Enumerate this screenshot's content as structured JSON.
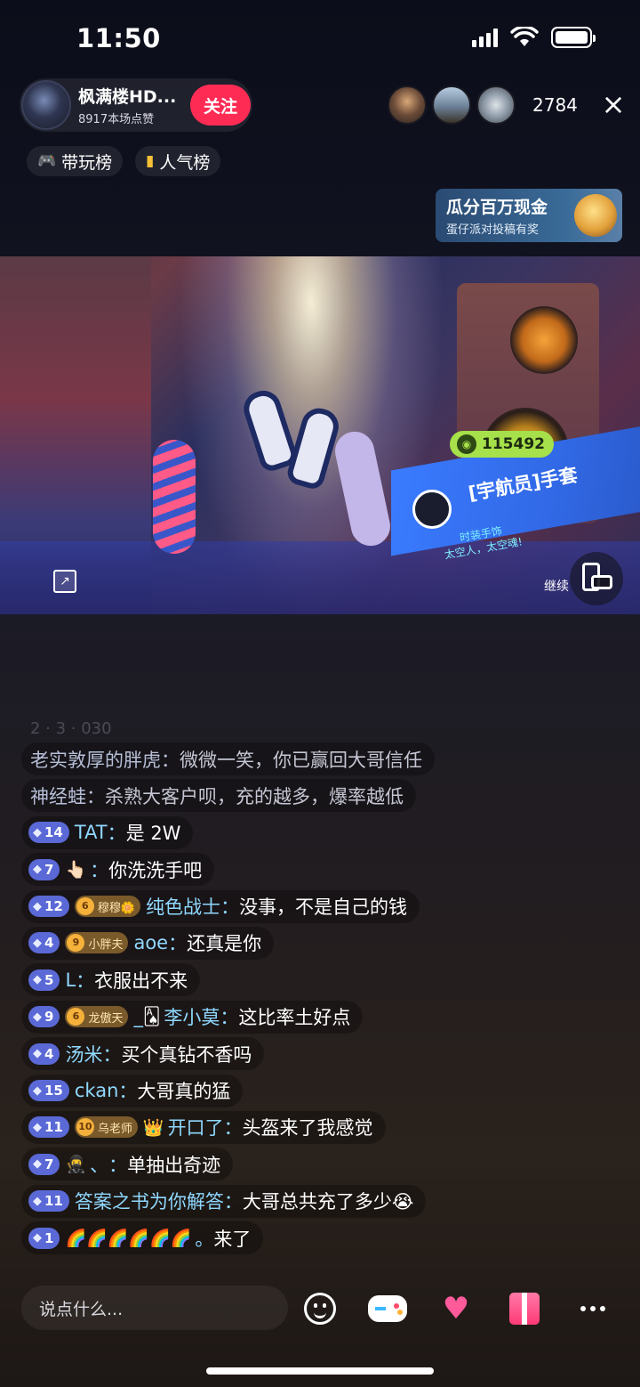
{
  "status_bar": {
    "time": "11:50"
  },
  "header": {
    "host_name": "枫满楼HD...",
    "host_likes": "8917本场点赞",
    "follow_label": "关注",
    "viewer_count": "2784",
    "close_icon": "×"
  },
  "rankings": [
    {
      "icon": "gamepad-icon",
      "label": "带玩榜"
    },
    {
      "icon": "bar-chart-icon",
      "label": "人气榜"
    }
  ],
  "promo": {
    "title": "瓜分百万现金",
    "subtitle": "蛋仔派对投稿有奖"
  },
  "video": {
    "coin_value": "115492",
    "item_name": "[宇航员]手套",
    "item_tag_line1": "时装手饰",
    "item_tag_line2": "太空人，太空魂!",
    "continue_label": "继续"
  },
  "chat": {
    "faded_line": "2 · 3 · 030",
    "messages": [
      {
        "name": "老实敦厚的胖虎",
        "sep": "：",
        "text": "微微一笑，你已赢回大哥信任"
      },
      {
        "name": "神经蛙",
        "sep": "：",
        "text": "杀熟大客户呗，充的越多，爆率越低"
      },
      {
        "level": "14",
        "name": "TAT",
        "sep": "：",
        "text": "是 2W"
      },
      {
        "level": "7",
        "name_emoji": "👆🏻",
        "sep": "：",
        "text": "你洗洗手吧"
      },
      {
        "level": "12",
        "fan_level": "6",
        "fan_name": "穆穆🌼",
        "name": "纯色战士",
        "sep": "：",
        "text": "没事，不是自己的钱"
      },
      {
        "level": "4",
        "fan_level": "9",
        "fan_name": "小胖夫",
        "name": "aoe",
        "sep": "：",
        "text": "还真是你"
      },
      {
        "level": "5",
        "name": "L",
        "sep": "：",
        "text": "衣服出不来"
      },
      {
        "level": "9",
        "fan_level": "6",
        "fan_name": "龙傲天",
        "name_prefix": "_",
        "name_emoji": "🂡",
        "name": "李小莫",
        "sep": "：",
        "text": "这比率土好点"
      },
      {
        "level": "4",
        "name": "汤米",
        "sep": "：",
        "text": "买个真钻不香吗"
      },
      {
        "level": "15",
        "name": "ckan",
        "sep": "：",
        "text": "大哥真的猛"
      },
      {
        "level": "11",
        "fan_level": "10",
        "fan_name": "乌老师",
        "name_emoji": "👑",
        "name": "开口了",
        "sep": "：",
        "text": "头盔来了我感觉"
      },
      {
        "level": "7",
        "name_emoji": "🥷",
        "name": "、",
        "sep": "：",
        "text": "单抽出奇迹"
      },
      {
        "level": "11",
        "name": "答案之书为你解答",
        "sep": "：",
        "text": "大哥总共充了多少😭"
      },
      {
        "level": "1",
        "name_emoji": "🌈🌈🌈🌈🌈🌈",
        "name": "。",
        "sep": "",
        "text": "来了"
      }
    ]
  },
  "bottom_bar": {
    "input_placeholder": "说点什么...",
    "buttons": [
      "emoji-icon",
      "gamepad-icon",
      "heart-icon",
      "gift-icon",
      "more-icon"
    ]
  }
}
